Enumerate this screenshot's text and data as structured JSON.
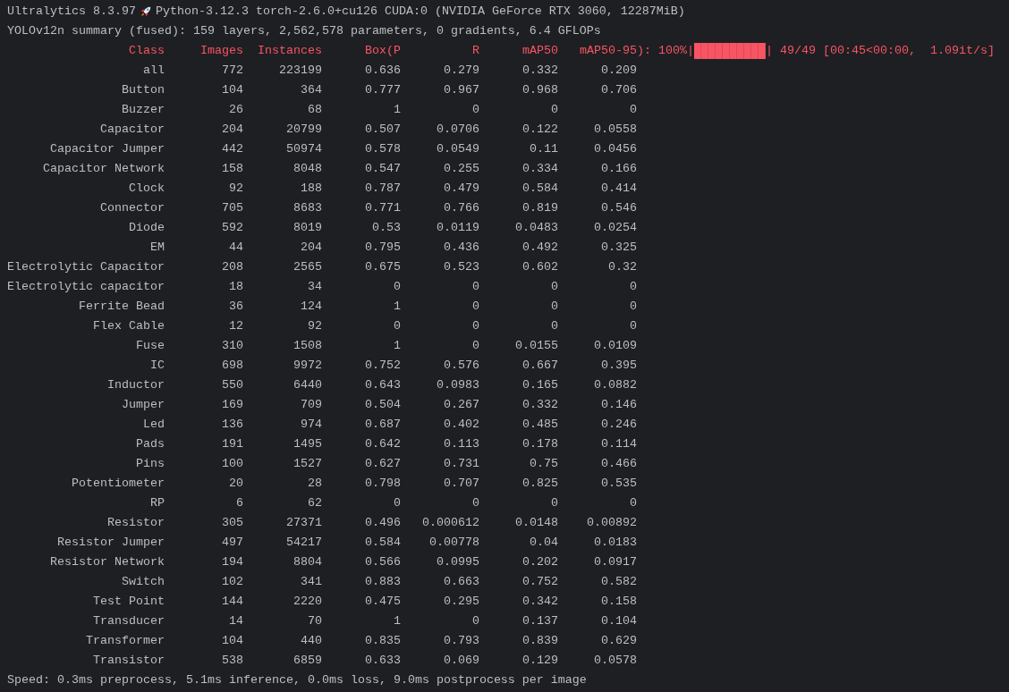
{
  "banner": {
    "before_icon": "Ultralytics 8.3.97",
    "after_icon": "Python-3.12.3 torch-2.6.0+cu126 CUDA:0 (NVIDIA GeForce RTX 3060, 12287MiB)"
  },
  "summary": "YOLOv12n summary (fused): 159 layers, 2,562,578 parameters, 0 gradients, 6.4 GFLOPs",
  "table": {
    "columns": [
      "Class",
      "Images",
      "Instances",
      "Box(P",
      "R",
      "mAP50",
      "mAP50-95"
    ],
    "progress": {
      "prefix": "): 100%|",
      "level": 1,
      "suffix": "| 49/49 [00:45<00:00,  1.09it/s]"
    },
    "rows": [
      [
        "all",
        "772",
        "223199",
        "0.636",
        "0.279",
        "0.332",
        "0.209"
      ],
      [
        "Button",
        "104",
        "364",
        "0.777",
        "0.967",
        "0.968",
        "0.706"
      ],
      [
        "Buzzer",
        "26",
        "68",
        "1",
        "0",
        "0",
        "0"
      ],
      [
        "Capacitor",
        "204",
        "20799",
        "0.507",
        "0.0706",
        "0.122",
        "0.0558"
      ],
      [
        "Capacitor Jumper",
        "442",
        "50974",
        "0.578",
        "0.0549",
        "0.11",
        "0.0456"
      ],
      [
        "Capacitor Network",
        "158",
        "8048",
        "0.547",
        "0.255",
        "0.334",
        "0.166"
      ],
      [
        "Clock",
        "92",
        "188",
        "0.787",
        "0.479",
        "0.584",
        "0.414"
      ],
      [
        "Connector",
        "705",
        "8683",
        "0.771",
        "0.766",
        "0.819",
        "0.546"
      ],
      [
        "Diode",
        "592",
        "8019",
        "0.53",
        "0.0119",
        "0.0483",
        "0.0254"
      ],
      [
        "EM",
        "44",
        "204",
        "0.795",
        "0.436",
        "0.492",
        "0.325"
      ],
      [
        "Electrolytic Capacitor",
        "208",
        "2565",
        "0.675",
        "0.523",
        "0.602",
        "0.32"
      ],
      [
        "Electrolytic capacitor",
        "18",
        "34",
        "0",
        "0",
        "0",
        "0"
      ],
      [
        "Ferrite Bead",
        "36",
        "124",
        "1",
        "0",
        "0",
        "0"
      ],
      [
        "Flex Cable",
        "12",
        "92",
        "0",
        "0",
        "0",
        "0"
      ],
      [
        "Fuse",
        "310",
        "1508",
        "1",
        "0",
        "0.0155",
        "0.0109"
      ],
      [
        "IC",
        "698",
        "9972",
        "0.752",
        "0.576",
        "0.667",
        "0.395"
      ],
      [
        "Inductor",
        "550",
        "6440",
        "0.643",
        "0.0983",
        "0.165",
        "0.0882"
      ],
      [
        "Jumper",
        "169",
        "709",
        "0.504",
        "0.267",
        "0.332",
        "0.146"
      ],
      [
        "Led",
        "136",
        "974",
        "0.687",
        "0.402",
        "0.485",
        "0.246"
      ],
      [
        "Pads",
        "191",
        "1495",
        "0.642",
        "0.113",
        "0.178",
        "0.114"
      ],
      [
        "Pins",
        "100",
        "1527",
        "0.627",
        "0.731",
        "0.75",
        "0.466"
      ],
      [
        "Potentiometer",
        "20",
        "28",
        "0.798",
        "0.707",
        "0.825",
        "0.535"
      ],
      [
        "RP",
        "6",
        "62",
        "0",
        "0",
        "0",
        "0"
      ],
      [
        "Resistor",
        "305",
        "27371",
        "0.496",
        "0.000612",
        "0.0148",
        "0.00892"
      ],
      [
        "Resistor Jumper",
        "497",
        "54217",
        "0.584",
        "0.00778",
        "0.04",
        "0.0183"
      ],
      [
        "Resistor Network",
        "194",
        "8804",
        "0.566",
        "0.0995",
        "0.202",
        "0.0917"
      ],
      [
        "Switch",
        "102",
        "341",
        "0.883",
        "0.663",
        "0.752",
        "0.582"
      ],
      [
        "Test Point",
        "144",
        "2220",
        "0.475",
        "0.295",
        "0.342",
        "0.158"
      ],
      [
        "Transducer",
        "14",
        "70",
        "1",
        "0",
        "0.137",
        "0.104"
      ],
      [
        "Transformer",
        "104",
        "440",
        "0.835",
        "0.793",
        "0.839",
        "0.629"
      ],
      [
        "Transistor",
        "538",
        "6859",
        "0.633",
        "0.069",
        "0.129",
        "0.0578"
      ]
    ]
  },
  "speed": "Speed: 0.3ms preprocess, 5.1ms inference, 0.0ms loss, 9.0ms postprocess per image"
}
